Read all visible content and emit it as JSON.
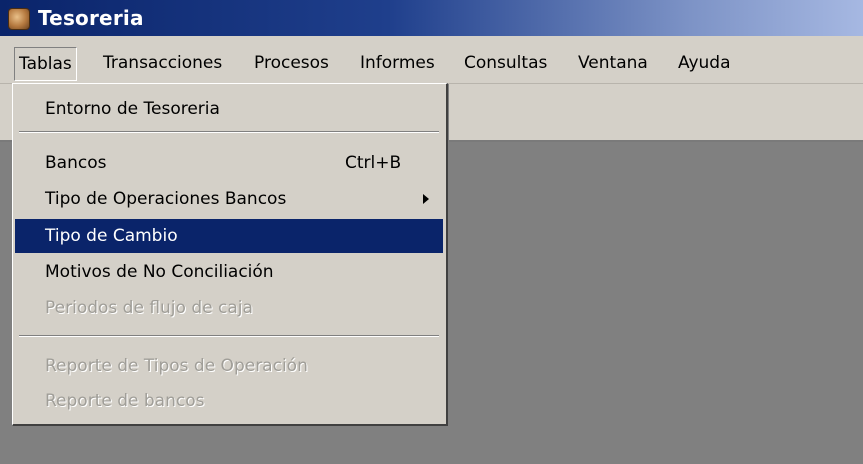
{
  "window": {
    "title": "Tesoreria",
    "icon": "app-icon"
  },
  "menubar": {
    "items": [
      {
        "label": "Tablas",
        "active": true
      },
      {
        "label": "Transacciones"
      },
      {
        "label": "Procesos"
      },
      {
        "label": "Informes"
      },
      {
        "label": "Consultas"
      },
      {
        "label": "Ventana"
      },
      {
        "label": "Ayuda"
      }
    ]
  },
  "tablas_menu": {
    "items": [
      {
        "label": "Entorno de Tesoreria",
        "enabled": true
      },
      {
        "separator": true
      },
      {
        "label": "Bancos",
        "shortcut": "Ctrl+B",
        "enabled": true
      },
      {
        "label": "Tipo de Operaciones Bancos",
        "submenu": true,
        "enabled": true
      },
      {
        "label": "Tipo de Cambio",
        "enabled": true,
        "highlighted": true
      },
      {
        "label": "Motivos de No Conciliación",
        "enabled": true
      },
      {
        "label": "Periodos de flujo de caja",
        "enabled": false
      },
      {
        "separator": true
      },
      {
        "label": "Reporte de Tipos de Operación",
        "enabled": false
      },
      {
        "label": "Reporte de bancos",
        "enabled": false
      }
    ]
  },
  "colors": {
    "title_bar_start": "#0a246a",
    "title_bar_end": "#a6b8e2",
    "menu_background": "#d4d0c8",
    "highlight": "#0a246a",
    "workspace": "#808080",
    "disabled_text": "#a09e98"
  }
}
